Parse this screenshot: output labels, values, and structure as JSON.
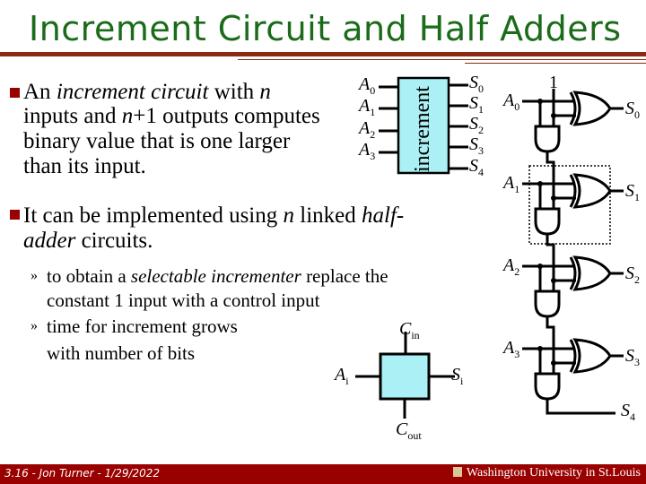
{
  "title": "Increment Circuit and Half Adders",
  "bullets": [
    {
      "lines": [
        {
          "parts": [
            {
              "t": "An ",
              "i": false
            },
            {
              "t": "increment circuit",
              "i": true
            },
            {
              "t": " with ",
              "i": false
            },
            {
              "t": "n",
              "i": true
            }
          ]
        },
        {
          "parts": [
            {
              "t": "inputs and ",
              "i": false
            },
            {
              "t": "n",
              "i": true
            },
            {
              "t": "+1 outputs computes",
              "i": false
            }
          ]
        },
        {
          "parts": [
            {
              "t": "binary value that is one larger",
              "i": false
            }
          ]
        },
        {
          "parts": [
            {
              "t": "than its input.",
              "i": false
            }
          ]
        }
      ]
    },
    {
      "lines": [
        {
          "parts": [
            {
              "t": "It can be implemented using ",
              "i": false
            },
            {
              "t": "n",
              "i": true
            },
            {
              "t": " linked ",
              "i": false
            },
            {
              "t": "half-",
              "i": true
            }
          ]
        },
        {
          "parts": [
            {
              "t": "adder",
              "i": true
            },
            {
              "t": " circuits.",
              "i": false
            }
          ]
        }
      ]
    }
  ],
  "subbullets": [
    {
      "marker": "»",
      "lines": [
        {
          "parts": [
            {
              "t": "to obtain a ",
              "i": false
            },
            {
              "t": "selectable incrementer",
              "i": true
            },
            {
              "t": " replace the",
              "i": false
            }
          ]
        },
        {
          "parts": [
            {
              "t": "constant 1 input with a control input",
              "i": false
            }
          ]
        }
      ]
    },
    {
      "marker": "»",
      "lines": [
        {
          "parts": [
            {
              "t": "time for increment grows",
              "i": false
            }
          ]
        },
        {
          "parts": [
            {
              "t": "with number of bits",
              "i": false
            }
          ]
        }
      ]
    }
  ],
  "increment_block": {
    "label": "increment",
    "inputs": [
      {
        "base": "A",
        "sub": "0"
      },
      {
        "base": "A",
        "sub": "1"
      },
      {
        "base": "A",
        "sub": "2"
      },
      {
        "base": "A",
        "sub": "3"
      }
    ],
    "outputs": [
      {
        "base": "S",
        "sub": "0"
      },
      {
        "base": "S",
        "sub": "1"
      },
      {
        "base": "S",
        "sub": "2"
      },
      {
        "base": "S",
        "sub": "3"
      },
      {
        "base": "S",
        "sub": "4"
      }
    ],
    "fill": "#aaf0f4"
  },
  "half_adder_cell": {
    "input": {
      "base": "A",
      "sub": "i"
    },
    "output": {
      "base": "S",
      "sub": "i"
    },
    "carry_in": {
      "base": "C",
      "sub": "in"
    },
    "carry_out": {
      "base": "C",
      "sub": "out"
    },
    "fill": "#aaf0f4"
  },
  "ripple_circuit": {
    "constant_input": "1",
    "inputs": [
      {
        "base": "A",
        "sub": "0"
      },
      {
        "base": "A",
        "sub": "1"
      },
      {
        "base": "A",
        "sub": "2"
      },
      {
        "base": "A",
        "sub": "3"
      }
    ],
    "outputs": [
      {
        "base": "S",
        "sub": "0"
      },
      {
        "base": "S",
        "sub": "1"
      },
      {
        "base": "S",
        "sub": "2"
      },
      {
        "base": "S",
        "sub": "3"
      },
      {
        "base": "S",
        "sub": "4"
      }
    ]
  },
  "footer": {
    "left": "3.16 - Jon Turner - 1/29/2022",
    "right": "Washington University in St.Louis"
  }
}
